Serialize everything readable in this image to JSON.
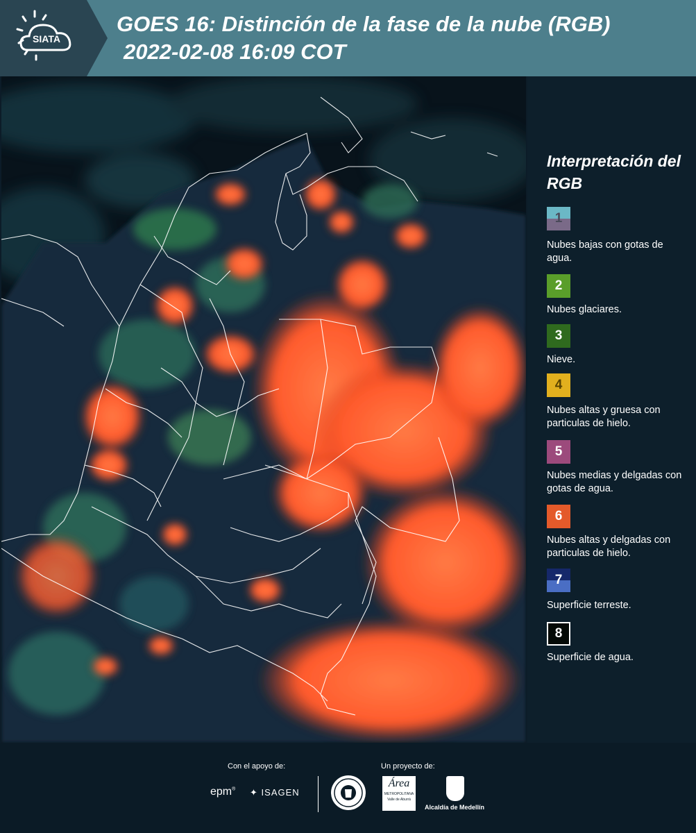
{
  "header": {
    "logo_text": "SIATA",
    "title": "GOES 16: Distinción de la fase de la nube (RGB)",
    "subtitle": "2022-02-08 16:09 COT",
    "background_color": "#4d7f8c"
  },
  "legend": {
    "title": "Interpretación del RGB",
    "items": [
      {
        "number": "1",
        "label": "Nubes bajas con gotas de agua.",
        "color_top": "#6bb8c6",
        "color_bottom": "#7a6a88"
      },
      {
        "number": "2",
        "label": "Nubes glaciares.",
        "color_top": "#5a9e2a",
        "color_bottom": "#5a9e2a"
      },
      {
        "number": "3",
        "label": "Nieve.",
        "color_top": "#2f6a1e",
        "color_bottom": "#2f6a1e"
      },
      {
        "number": "4",
        "label": "Nubes altas y gruesa con particulas de hielo.",
        "color_top": "#e2b01e",
        "color_bottom": "#e2b01e"
      },
      {
        "number": "5",
        "label": "Nubes medias y delgadas con gotas de agua.",
        "color_top": "#9c4a7c",
        "color_bottom": "#9c4a7c"
      },
      {
        "number": "6",
        "label": "Nubes altas y delgadas con particulas de hielo.",
        "color_top": "#e45a2a",
        "color_bottom": "#e45a2a"
      },
      {
        "number": "7",
        "label": "Superficie terreste.",
        "color_top": "#16286a",
        "color_bottom": "#4a6ec4"
      },
      {
        "number": "8",
        "label": "Superficie de agua.",
        "color_top": "#050a06",
        "color_bottom": "#050a06"
      }
    ]
  },
  "footer": {
    "support_label": "Con el apoyo de:",
    "project_label": "Un proyecto de:",
    "epm": "epm",
    "isagen": "ISAGEN",
    "area_name": "Área",
    "area_sub1": "METROPOLITANA",
    "area_sub2": "Valle de Aburrá",
    "alcaldia": "Alcaldía de Medellín"
  },
  "map": {
    "palette": {
      "cloud_ice": "#ff6a3a",
      "cloud_ice_dark": "#d84a22",
      "low_cloud": "#3e7f8a",
      "land": "#16324a",
      "green_fringe": "#3f9a58",
      "water": "#08141c",
      "borders": "#ffffff"
    }
  }
}
